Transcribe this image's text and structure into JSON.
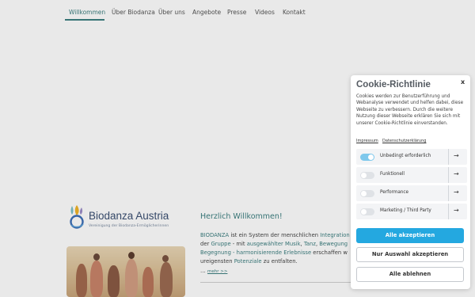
{
  "nav": {
    "items": [
      {
        "label": "Willkommen",
        "active": true
      },
      {
        "label": "Über Biodanza"
      },
      {
        "label": "Über uns"
      },
      {
        "label": "Angebote"
      },
      {
        "label": "Presse"
      },
      {
        "label": "Videos"
      },
      {
        "label": "Kontakt"
      }
    ]
  },
  "logo": {
    "name": "Biodanza Austria",
    "subtitle": "Vereinigung der Biodanza-Ermöglicherinnen"
  },
  "welcome": {
    "heading": "Herzlich Willkommen!",
    "line1": [
      "BIODANZA",
      " ist ein System der menschlichen ",
      "Integration"
    ],
    "line2": [
      "der ",
      "Gruppe",
      " - mit ",
      "ausgewählter Musik",
      ", ",
      "Tanz",
      ", ",
      "Bewegung"
    ],
    "line3": [
      "Begegnung - harmonisierende Erlebnisse",
      " erschaffen w"
    ],
    "line4": [
      "ureigensten ",
      "Potenziale",
      " zu entfalten."
    ],
    "more_prefix": "…",
    "more_link": "mehr >>"
  },
  "cookie": {
    "title": "Cookie-Richtlinie",
    "close": "x",
    "description": "Cookies werden zur Benutzerführung und Webanalyse verwendet und helfen dabei, diese Webseite zu verbessern. Durch die weitere Nutzung dieser Webseite erklären Sie sich mit unserer Cookie-Richtlinie einverstanden.",
    "links": {
      "impressum": "Impressum",
      "datenschutz": "Datenschutzerklärung"
    },
    "categories": [
      {
        "label": "Unbedingt erforderlich",
        "enabled": true
      },
      {
        "label": "Funktionell",
        "enabled": false
      },
      {
        "label": "Performance",
        "enabled": false
      },
      {
        "label": "Marketing / Third Party",
        "enabled": false
      }
    ],
    "arrow": "→",
    "buttons": {
      "accept_all": "Alle akzeptieren",
      "accept_selection": "Nur Auswahl akzeptieren",
      "reject_all": "Alle ablehnen"
    }
  },
  "colors": {
    "accent": "#3d7f80",
    "button_primary": "#24a8e0",
    "toggle_on": "#7ec8ec"
  }
}
